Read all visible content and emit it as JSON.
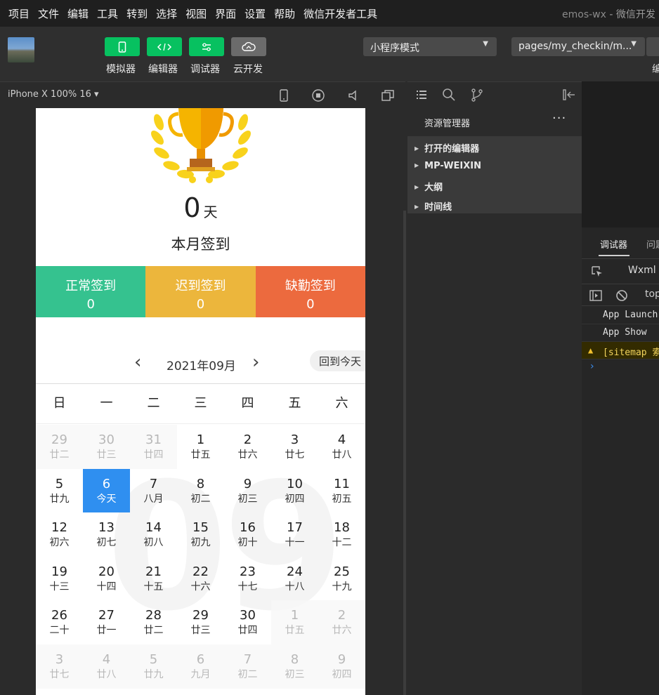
{
  "menubar": {
    "items": [
      "项目",
      "文件",
      "编辑",
      "工具",
      "转到",
      "选择",
      "视图",
      "界面",
      "设置",
      "帮助",
      "微信开发者工具"
    ],
    "project": "emos-wx",
    "app_title": " - 微信开发"
  },
  "toolbar": {
    "buttons": [
      {
        "label": "模拟器",
        "icon": "phone-icon"
      },
      {
        "label": "编辑器",
        "icon": "code-icon"
      },
      {
        "label": "调试器",
        "icon": "debug-icon"
      },
      {
        "label": "云开发",
        "icon": "cloud-icon"
      }
    ],
    "mode_select": "小程序模式",
    "page_select": "pages/my_checkin/m...",
    "cut_label": "编"
  },
  "simulator": {
    "device": "iPhone X 100% 16 ▾"
  },
  "page": {
    "days_num": "0",
    "days_unit": "天",
    "month_label": "本月签到",
    "stats": [
      {
        "label": "正常签到",
        "value": "0",
        "color": "#35c28f"
      },
      {
        "label": "迟到签到",
        "value": "0",
        "color": "#ecb63c"
      },
      {
        "label": "缺勤签到",
        "value": "0",
        "color": "#ec6a3e"
      }
    ],
    "calendar": {
      "prev": "‹",
      "next": "›",
      "year_month": "2021年09月",
      "today_button": "回到今天",
      "watermark": "09",
      "weekdays": [
        "日",
        "一",
        "二",
        "三",
        "四",
        "五",
        "六"
      ],
      "weeks": [
        [
          {
            "d": "29",
            "l": "廿二",
            "o": true
          },
          {
            "d": "30",
            "l": "廿三",
            "o": true
          },
          {
            "d": "31",
            "l": "廿四",
            "o": true
          },
          {
            "d": "1",
            "l": "廿五"
          },
          {
            "d": "2",
            "l": "廿六"
          },
          {
            "d": "3",
            "l": "廿七"
          },
          {
            "d": "4",
            "l": "廿八"
          }
        ],
        [
          {
            "d": "5",
            "l": "廿九"
          },
          {
            "d": "6",
            "l": "今天",
            "t": true
          },
          {
            "d": "7",
            "l": "八月"
          },
          {
            "d": "8",
            "l": "初二"
          },
          {
            "d": "9",
            "l": "初三"
          },
          {
            "d": "10",
            "l": "初四"
          },
          {
            "d": "11",
            "l": "初五"
          }
        ],
        [
          {
            "d": "12",
            "l": "初六"
          },
          {
            "d": "13",
            "l": "初七"
          },
          {
            "d": "14",
            "l": "初八"
          },
          {
            "d": "15",
            "l": "初九"
          },
          {
            "d": "16",
            "l": "初十"
          },
          {
            "d": "17",
            "l": "十一"
          },
          {
            "d": "18",
            "l": "十二"
          }
        ],
        [
          {
            "d": "19",
            "l": "十三"
          },
          {
            "d": "20",
            "l": "十四"
          },
          {
            "d": "21",
            "l": "十五"
          },
          {
            "d": "22",
            "l": "十六"
          },
          {
            "d": "23",
            "l": "十七"
          },
          {
            "d": "24",
            "l": "十八"
          },
          {
            "d": "25",
            "l": "十九"
          }
        ],
        [
          {
            "d": "26",
            "l": "二十"
          },
          {
            "d": "27",
            "l": "廿一"
          },
          {
            "d": "28",
            "l": "廿二"
          },
          {
            "d": "29",
            "l": "廿三"
          },
          {
            "d": "30",
            "l": "廿四"
          },
          {
            "d": "1",
            "l": "廿五",
            "o": true
          },
          {
            "d": "2",
            "l": "廿六",
            "o": true
          }
        ],
        [
          {
            "d": "3",
            "l": "廿七",
            "o": true
          },
          {
            "d": "4",
            "l": "廿八",
            "o": true
          },
          {
            "d": "5",
            "l": "廿九",
            "o": true
          },
          {
            "d": "6",
            "l": "九月",
            "o": true
          },
          {
            "d": "7",
            "l": "初二",
            "o": true
          },
          {
            "d": "8",
            "l": "初三",
            "o": true
          },
          {
            "d": "9",
            "l": "初四",
            "o": true
          }
        ]
      ]
    }
  },
  "explorer": {
    "title": "资源管理器",
    "more": "···",
    "items": [
      "打开的编辑器",
      "MP-WEIXIN",
      "大纲",
      "时间线"
    ]
  },
  "debugger": {
    "tab_debugger": "调试器",
    "tab_problems": "问题",
    "wxml_tab": "Wxml",
    "context": "top",
    "logs": [
      "App Launch",
      "App Show"
    ],
    "warning": "[sitemap 索",
    "prompt": "›"
  }
}
